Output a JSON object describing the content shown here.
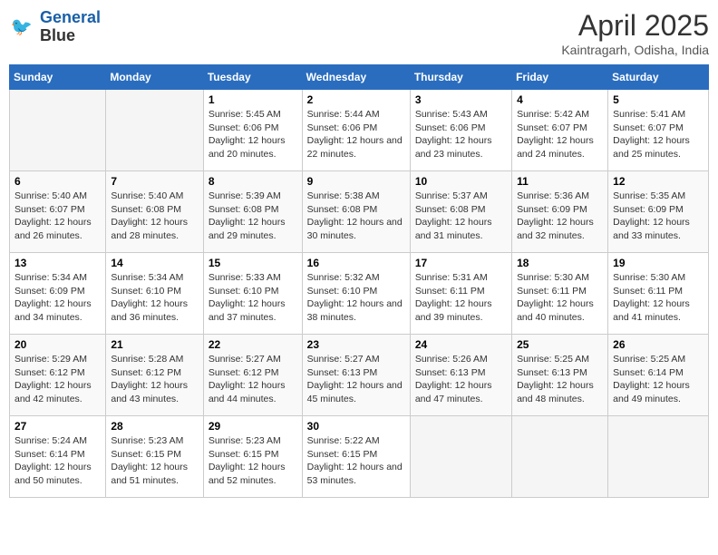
{
  "header": {
    "logo_line1": "General",
    "logo_line2": "Blue",
    "month_year": "April 2025",
    "location": "Kaintragarh, Odisha, India"
  },
  "weekdays": [
    "Sunday",
    "Monday",
    "Tuesday",
    "Wednesday",
    "Thursday",
    "Friday",
    "Saturday"
  ],
  "weeks": [
    [
      {
        "day": "",
        "info": ""
      },
      {
        "day": "",
        "info": ""
      },
      {
        "day": "1",
        "info": "Sunrise: 5:45 AM\nSunset: 6:06 PM\nDaylight: 12 hours and 20 minutes."
      },
      {
        "day": "2",
        "info": "Sunrise: 5:44 AM\nSunset: 6:06 PM\nDaylight: 12 hours and 22 minutes."
      },
      {
        "day": "3",
        "info": "Sunrise: 5:43 AM\nSunset: 6:06 PM\nDaylight: 12 hours and 23 minutes."
      },
      {
        "day": "4",
        "info": "Sunrise: 5:42 AM\nSunset: 6:07 PM\nDaylight: 12 hours and 24 minutes."
      },
      {
        "day": "5",
        "info": "Sunrise: 5:41 AM\nSunset: 6:07 PM\nDaylight: 12 hours and 25 minutes."
      }
    ],
    [
      {
        "day": "6",
        "info": "Sunrise: 5:40 AM\nSunset: 6:07 PM\nDaylight: 12 hours and 26 minutes."
      },
      {
        "day": "7",
        "info": "Sunrise: 5:40 AM\nSunset: 6:08 PM\nDaylight: 12 hours and 28 minutes."
      },
      {
        "day": "8",
        "info": "Sunrise: 5:39 AM\nSunset: 6:08 PM\nDaylight: 12 hours and 29 minutes."
      },
      {
        "day": "9",
        "info": "Sunrise: 5:38 AM\nSunset: 6:08 PM\nDaylight: 12 hours and 30 minutes."
      },
      {
        "day": "10",
        "info": "Sunrise: 5:37 AM\nSunset: 6:08 PM\nDaylight: 12 hours and 31 minutes."
      },
      {
        "day": "11",
        "info": "Sunrise: 5:36 AM\nSunset: 6:09 PM\nDaylight: 12 hours and 32 minutes."
      },
      {
        "day": "12",
        "info": "Sunrise: 5:35 AM\nSunset: 6:09 PM\nDaylight: 12 hours and 33 minutes."
      }
    ],
    [
      {
        "day": "13",
        "info": "Sunrise: 5:34 AM\nSunset: 6:09 PM\nDaylight: 12 hours and 34 minutes."
      },
      {
        "day": "14",
        "info": "Sunrise: 5:34 AM\nSunset: 6:10 PM\nDaylight: 12 hours and 36 minutes."
      },
      {
        "day": "15",
        "info": "Sunrise: 5:33 AM\nSunset: 6:10 PM\nDaylight: 12 hours and 37 minutes."
      },
      {
        "day": "16",
        "info": "Sunrise: 5:32 AM\nSunset: 6:10 PM\nDaylight: 12 hours and 38 minutes."
      },
      {
        "day": "17",
        "info": "Sunrise: 5:31 AM\nSunset: 6:11 PM\nDaylight: 12 hours and 39 minutes."
      },
      {
        "day": "18",
        "info": "Sunrise: 5:30 AM\nSunset: 6:11 PM\nDaylight: 12 hours and 40 minutes."
      },
      {
        "day": "19",
        "info": "Sunrise: 5:30 AM\nSunset: 6:11 PM\nDaylight: 12 hours and 41 minutes."
      }
    ],
    [
      {
        "day": "20",
        "info": "Sunrise: 5:29 AM\nSunset: 6:12 PM\nDaylight: 12 hours and 42 minutes."
      },
      {
        "day": "21",
        "info": "Sunrise: 5:28 AM\nSunset: 6:12 PM\nDaylight: 12 hours and 43 minutes."
      },
      {
        "day": "22",
        "info": "Sunrise: 5:27 AM\nSunset: 6:12 PM\nDaylight: 12 hours and 44 minutes."
      },
      {
        "day": "23",
        "info": "Sunrise: 5:27 AM\nSunset: 6:13 PM\nDaylight: 12 hours and 45 minutes."
      },
      {
        "day": "24",
        "info": "Sunrise: 5:26 AM\nSunset: 6:13 PM\nDaylight: 12 hours and 47 minutes."
      },
      {
        "day": "25",
        "info": "Sunrise: 5:25 AM\nSunset: 6:13 PM\nDaylight: 12 hours and 48 minutes."
      },
      {
        "day": "26",
        "info": "Sunrise: 5:25 AM\nSunset: 6:14 PM\nDaylight: 12 hours and 49 minutes."
      }
    ],
    [
      {
        "day": "27",
        "info": "Sunrise: 5:24 AM\nSunset: 6:14 PM\nDaylight: 12 hours and 50 minutes."
      },
      {
        "day": "28",
        "info": "Sunrise: 5:23 AM\nSunset: 6:15 PM\nDaylight: 12 hours and 51 minutes."
      },
      {
        "day": "29",
        "info": "Sunrise: 5:23 AM\nSunset: 6:15 PM\nDaylight: 12 hours and 52 minutes."
      },
      {
        "day": "30",
        "info": "Sunrise: 5:22 AM\nSunset: 6:15 PM\nDaylight: 12 hours and 53 minutes."
      },
      {
        "day": "",
        "info": ""
      },
      {
        "day": "",
        "info": ""
      },
      {
        "day": "",
        "info": ""
      }
    ]
  ]
}
